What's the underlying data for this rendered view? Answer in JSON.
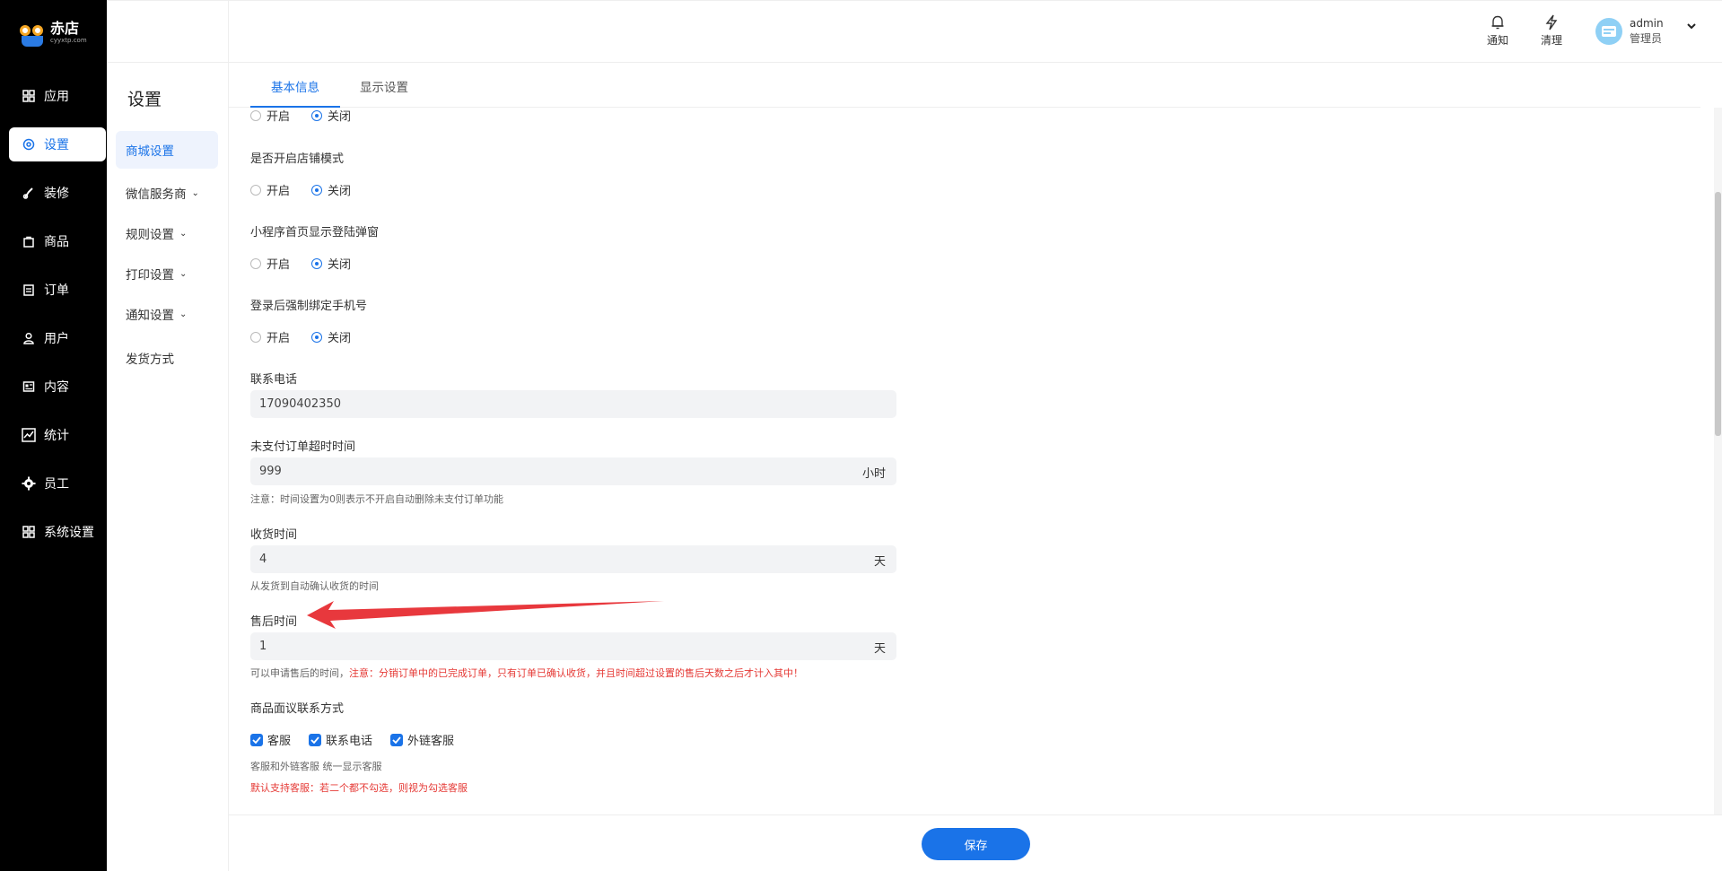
{
  "brand": {
    "name": "赤店",
    "url": "cyyxtp.com"
  },
  "nav": {
    "items": [
      {
        "label": "应用",
        "icon": "apps-icon"
      },
      {
        "label": "设置",
        "icon": "gear-icon",
        "active": true
      },
      {
        "label": "装修",
        "icon": "brush-icon"
      },
      {
        "label": "商品",
        "icon": "bag-icon"
      },
      {
        "label": "订单",
        "icon": "order-icon"
      },
      {
        "label": "用户",
        "icon": "user-icon"
      },
      {
        "label": "内容",
        "icon": "content-icon"
      },
      {
        "label": "统计",
        "icon": "chart-icon"
      },
      {
        "label": "员工",
        "icon": "staff-gear-icon"
      },
      {
        "label": "系统设置",
        "icon": "apps-icon"
      }
    ]
  },
  "submenu": {
    "title": "设置",
    "items": [
      {
        "label": "商城设置",
        "active": true
      },
      {
        "label": "微信服务商",
        "expandable": true
      },
      {
        "label": "规则设置",
        "expandable": true
      },
      {
        "label": "打印设置",
        "expandable": true
      },
      {
        "label": "通知设置",
        "expandable": true
      },
      {
        "label": "发货方式"
      }
    ]
  },
  "topbar": {
    "notify_label": "通知",
    "clear_label": "清理",
    "user_name": "admin",
    "user_role": "管理员"
  },
  "tabs": [
    {
      "label": "基本信息",
      "active": true
    },
    {
      "label": "显示设置"
    }
  ],
  "form": {
    "option_on": "开启",
    "option_off": "关闭",
    "store_mode_label": "是否开启店铺模式",
    "login_popup_label": "小程序首页显示登陆弹窗",
    "bind_phone_label": "登录后强制绑定手机号",
    "phone_label": "联系电话",
    "phone_value": "17090402350",
    "unpaid_timeout_label": "未支付订单超时时间",
    "unpaid_timeout_value": "999",
    "unpaid_timeout_unit": "小时",
    "unpaid_timeout_hint": "注意：时间设置为0则表示不开启自动删除未支付订单功能",
    "receive_label": "收货时间",
    "receive_value": "4",
    "receive_unit": "天",
    "receive_hint": "从发货到自动确认收货的时间",
    "aftersale_label": "售后时间",
    "aftersale_value": "1",
    "aftersale_unit": "天",
    "aftersale_hint": "可以申请售后的时间，",
    "aftersale_warn": "注意：分销订单中的已完成订单，只有订单已确认收货，并且时间超过设置的售后天数之后才计入其中！",
    "contact_label": "商品面议联系方式",
    "contact_options": [
      "客服",
      "联系电话",
      "外链客服"
    ],
    "contact_hint": "客服和外链客服 统一显示客服",
    "contact_warn": "默认支持客服：若二个都不勾选，则视为勾选客服"
  },
  "footer": {
    "save_label": "保存"
  },
  "colors": {
    "accent": "#1a73e8",
    "warn": "#e53935",
    "annotation_arrow": "#e8383d"
  }
}
